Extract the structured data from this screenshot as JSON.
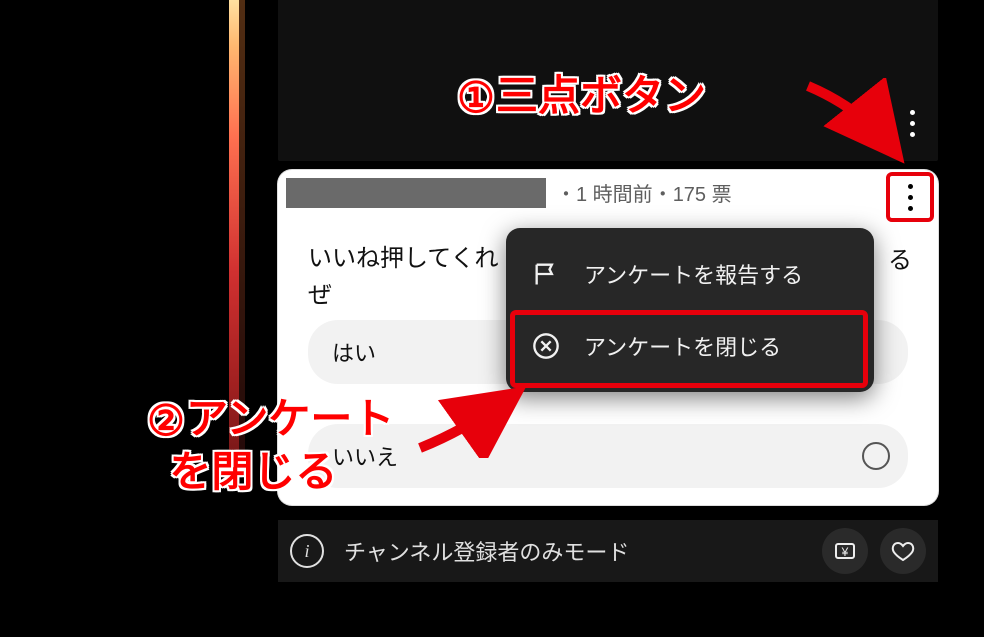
{
  "poll": {
    "meta_prefix": "・",
    "time_ago": "1 時間前",
    "separator": "・",
    "votes": "175 票",
    "question_line1": "いいね押してくれ",
    "question_line2": "ぜ",
    "question_truncated_tail": "る",
    "options": [
      {
        "label": "はい"
      },
      {
        "label": "いいえ"
      }
    ]
  },
  "menu": {
    "report": "アンケートを報告する",
    "close": "アンケートを閉じる"
  },
  "footer": {
    "mode_text": "チャンネル登録者のみモード",
    "currency_symbol": "¥"
  },
  "annotations": {
    "num1": "①",
    "label1": "三点ボタン",
    "num2": "②",
    "label2_line1": "アンケート",
    "label2_line2": "を閉じる"
  }
}
